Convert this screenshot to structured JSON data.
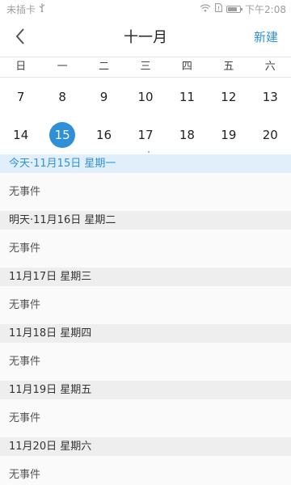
{
  "status": {
    "carrier": "未插卡",
    "time": "下午2:08",
    "battery_level": 0.75
  },
  "header": {
    "title": "十一月",
    "new_label": "新建"
  },
  "calendar": {
    "weekdays": [
      "日",
      "一",
      "二",
      "三",
      "四",
      "五",
      "六"
    ],
    "week1": [
      "7",
      "8",
      "9",
      "10",
      "11",
      "12",
      "13"
    ],
    "week2": [
      "14",
      "15",
      "16",
      "17",
      "18",
      "19",
      "20"
    ],
    "today": "15"
  },
  "events": [
    {
      "header": "今天·11月15日 星期一",
      "body": "无事件"
    },
    {
      "header": "明天·11月16日 星期二",
      "body": "无事件"
    },
    {
      "header": "11月17日 星期三",
      "body": "无事件"
    },
    {
      "header": "11月18日 星期四",
      "body": "无事件"
    },
    {
      "header": "11月19日 星期五",
      "body": "无事件"
    },
    {
      "header": "11月20日 星期六",
      "body": "无事件"
    }
  ],
  "colors": {
    "accent": "#2f8fd8",
    "today_header_bg": "#e1effa",
    "header_bg": "#eeeeee"
  }
}
